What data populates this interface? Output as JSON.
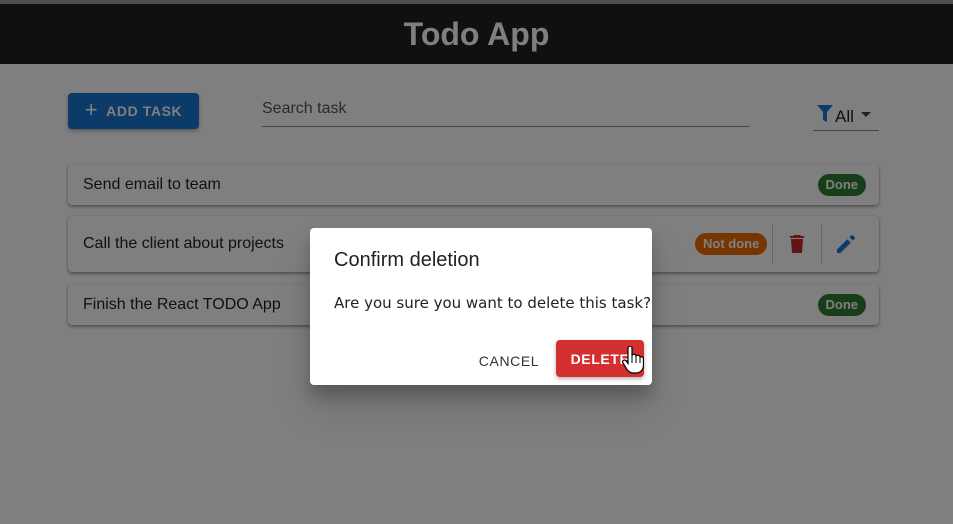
{
  "app": {
    "title": "Todo App"
  },
  "toolbar": {
    "add_label": "ADD TASK",
    "add_icon": "plus-icon",
    "search_placeholder": "Search task",
    "filter_icon": "funnel-icon",
    "filter_value": "All"
  },
  "tasks": [
    {
      "title": "Send email to team",
      "status": "Done"
    },
    {
      "title": "Call the client about projects",
      "status": "Not done",
      "actions": [
        "trash-icon",
        "pencil-icon"
      ]
    },
    {
      "title": "Finish the React TODO App",
      "status": "Done"
    }
  ],
  "dialog": {
    "title": "Confirm deletion",
    "message": "Are you sure you want to delete this task?",
    "cancel_label": "CANCEL",
    "delete_label": "DELETE"
  },
  "colors": {
    "appbar": "#212121",
    "primary": "#1976d2",
    "done": "#2e7d32",
    "not_done": "#ed6c02",
    "danger": "#d32f2f"
  }
}
